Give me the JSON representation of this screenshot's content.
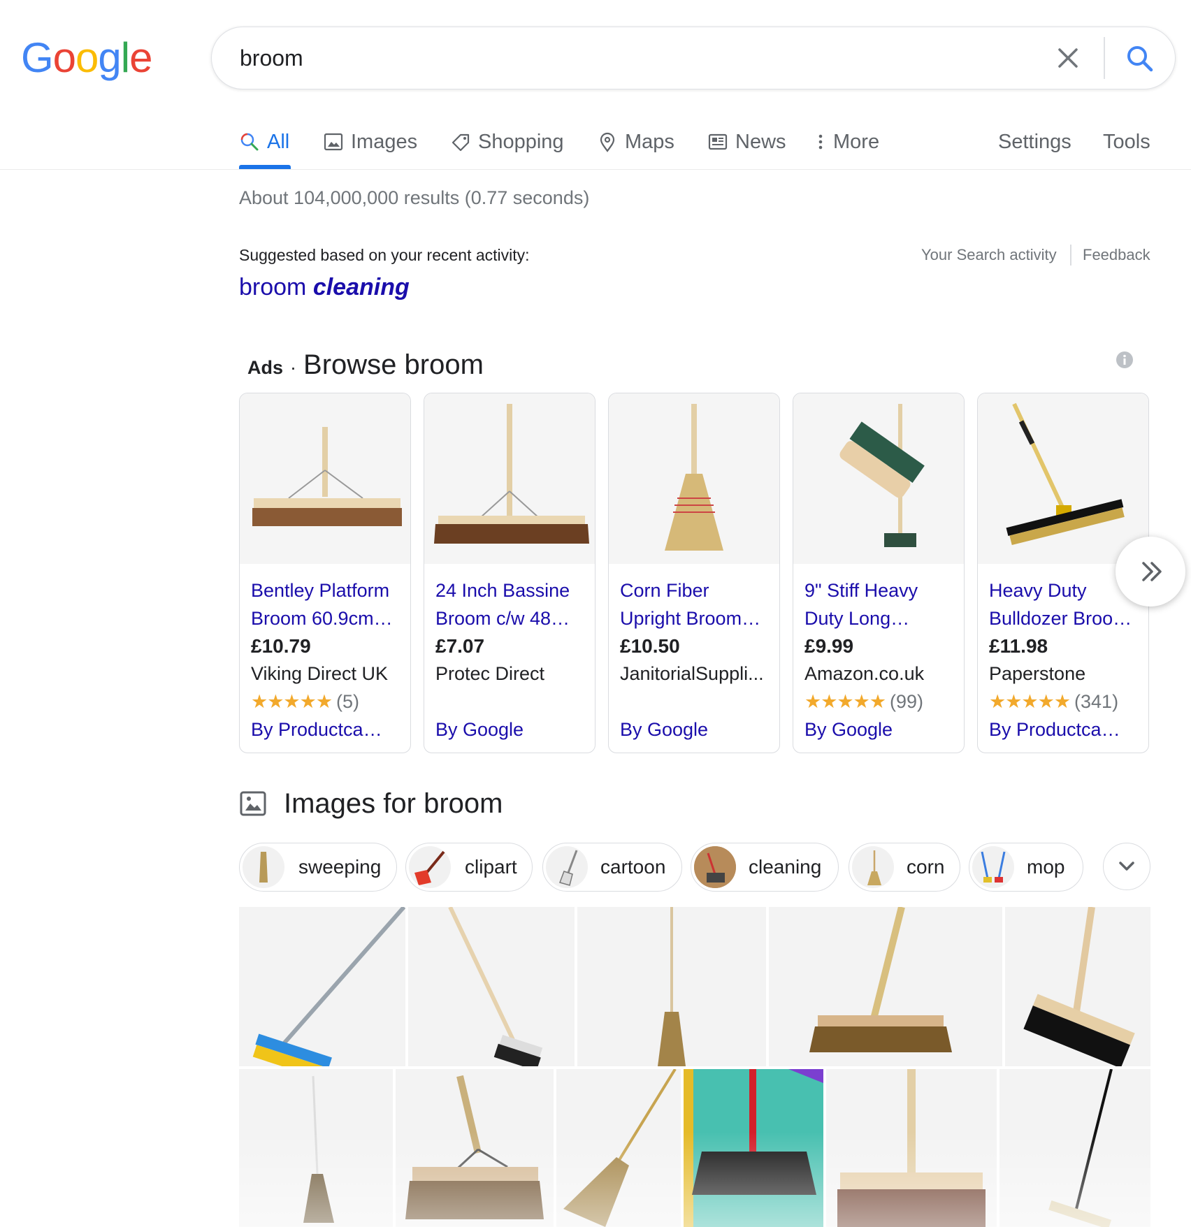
{
  "logo": {
    "letters": [
      "G",
      "o",
      "o",
      "g",
      "l",
      "e"
    ],
    "colors": [
      "#4285f4",
      "#ea4335",
      "#fbbc05",
      "#4285f4",
      "#34a853",
      "#ea4335"
    ]
  },
  "search": {
    "query": "broom"
  },
  "tabs": [
    {
      "label": "All",
      "icon": "search-icon",
      "active": true
    },
    {
      "label": "Images",
      "icon": "image-icon"
    },
    {
      "label": "Shopping",
      "icon": "tag-icon"
    },
    {
      "label": "Maps",
      "icon": "map-pin-icon"
    },
    {
      "label": "News",
      "icon": "news-icon"
    },
    {
      "label": "More",
      "icon": "more-vert-icon"
    }
  ],
  "tools": {
    "settings": "Settings",
    "tools": "Tools"
  },
  "stats": "About 104,000,000 results (0.77 seconds)",
  "suggested": {
    "label": "Suggested based on your recent activity:",
    "query_plain": "broom",
    "query_bold": "cleaning",
    "your_activity": "Your Search activity",
    "feedback": "Feedback"
  },
  "ads": {
    "label": "Ads",
    "separator": "·",
    "title": "Browse broom",
    "items": [
      {
        "title": "Bentley Platform Broom 60.9cm…",
        "price": "£10.79",
        "merchant": "Viking Direct UK",
        "stars": "★★★★★",
        "rating_count": "(5)",
        "by": "By Productca…"
      },
      {
        "title": "24 Inch Bassine Broom c/w 48…",
        "price": "£7.07",
        "merchant": "Protec Direct",
        "stars": "",
        "rating_count": "",
        "by": "By Google"
      },
      {
        "title": "Corn Fiber Upright Broom…",
        "price": "£10.50",
        "merchant": "JanitorialSuppli...",
        "stars": "",
        "rating_count": "",
        "by": "By Google"
      },
      {
        "title": "9\" Stiff Heavy Duty Long…",
        "price": "£9.99",
        "merchant": "Amazon.co.uk",
        "stars": "★★★★★",
        "rating_count": "(99)",
        "by": "By Google"
      },
      {
        "title": "Heavy Duty Bulldozer Broo…",
        "price": "£11.98",
        "merchant": "Paperstone",
        "stars": "★★★★★",
        "rating_count": "(341)",
        "by": "By Productca…"
      }
    ]
  },
  "images": {
    "title": "Images for broom",
    "chips": [
      {
        "label": "sweeping"
      },
      {
        "label": "clipart"
      },
      {
        "label": "cartoon"
      },
      {
        "label": "cleaning"
      },
      {
        "label": "corn"
      },
      {
        "label": "mop"
      }
    ]
  }
}
